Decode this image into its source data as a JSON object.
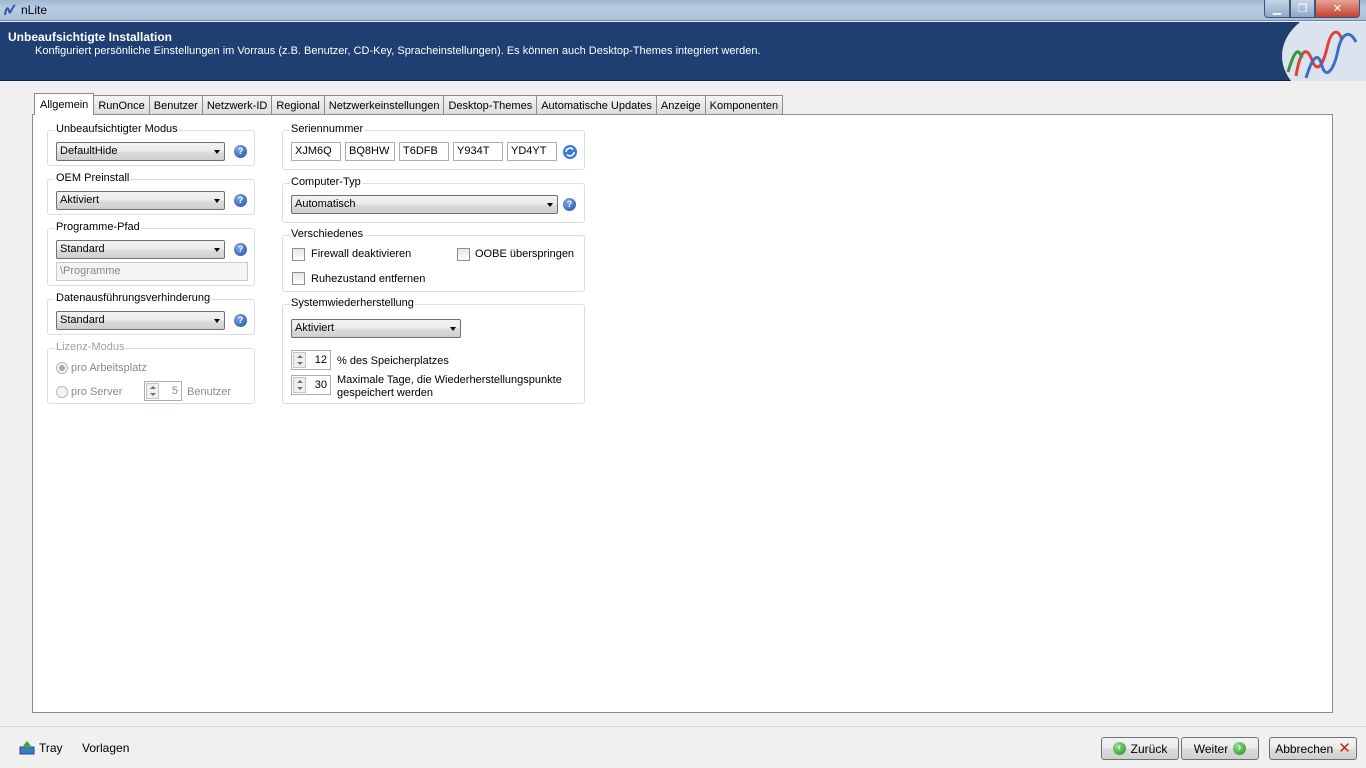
{
  "window": {
    "title": "nLite"
  },
  "header": {
    "title": "Unbeaufsichtigte Installation",
    "subtitle": "Konfiguriert persönliche Einstellungen im Vorraus (z.B. Benutzer, CD-Key, Spracheinstellungen). Es können auch Desktop-Themes integriert werden."
  },
  "tabs": [
    "Allgemein",
    "RunOnce",
    "Benutzer",
    "Netzwerk-ID",
    "Regional",
    "Netzwerkeinstellungen",
    "Desktop-Themes",
    "Automatische Updates",
    "Anzeige",
    "Komponenten"
  ],
  "left": {
    "unattended": {
      "legend": "Unbeaufsichtigter Modus",
      "value": "DefaultHide"
    },
    "oem": {
      "legend": "OEM Preinstall",
      "value": "Aktiviert"
    },
    "progpath": {
      "legend": "Programme-Pfad",
      "value": "Standard",
      "path": "\\Programme"
    },
    "dep": {
      "legend": "Datenausführungsverhinderung",
      "value": "Standard"
    },
    "license": {
      "legend": "Lizenz-Modus",
      "per_seat": "pro Arbeitsplatz",
      "per_server": "pro Server",
      "server_count": "5",
      "users_label": "Benutzer"
    }
  },
  "right": {
    "serial": {
      "legend": "Seriennummer",
      "parts": [
        "XJM6Q",
        "BQ8HW",
        "T6DFB",
        "Y934T",
        "YD4YT"
      ]
    },
    "computer": {
      "legend": "Computer-Typ",
      "value": "Automatisch"
    },
    "misc": {
      "legend": "Verschiedenes",
      "firewall": "Firewall deaktivieren",
      "oobe": "OOBE überspringen",
      "hibernate": "Ruhezustand entfernen"
    },
    "restore": {
      "legend": "Systemwiederherstellung",
      "value": "Aktiviert",
      "percent": "12",
      "percent_label": "% des Speicherplatzes",
      "days": "30",
      "days_label_1": "Maximale Tage, die Wiederherstellungspunkte",
      "days_label_2": "gespeichert werden"
    }
  },
  "bottom": {
    "tray": "Tray",
    "presets": "Vorlagen",
    "back": "Zurück",
    "next": "Weiter",
    "cancel": "Abbrechen"
  }
}
